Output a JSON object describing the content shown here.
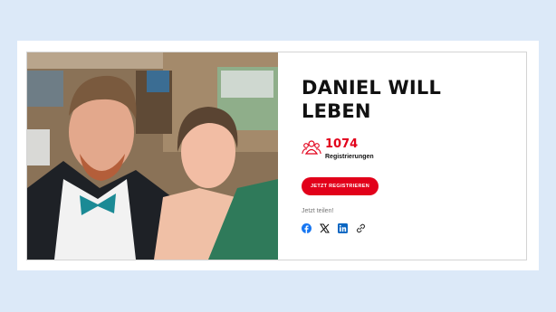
{
  "campaign": {
    "title": "DANIEL WILL LEBEN",
    "registrations_count": "1074",
    "registrations_label": "Registrierungen",
    "cta_label": "JETZT REGISTRIEREN",
    "share_prompt": "Jetzt teilen!"
  },
  "share_icons": [
    "facebook-icon",
    "x-icon",
    "linkedin-icon",
    "link-icon"
  ],
  "colors": {
    "accent": "#e2001a",
    "page_background": "#dce9f8",
    "card_border": "#d4d4d4",
    "facebook": "#1877f2",
    "linkedin": "#0a66c2"
  }
}
